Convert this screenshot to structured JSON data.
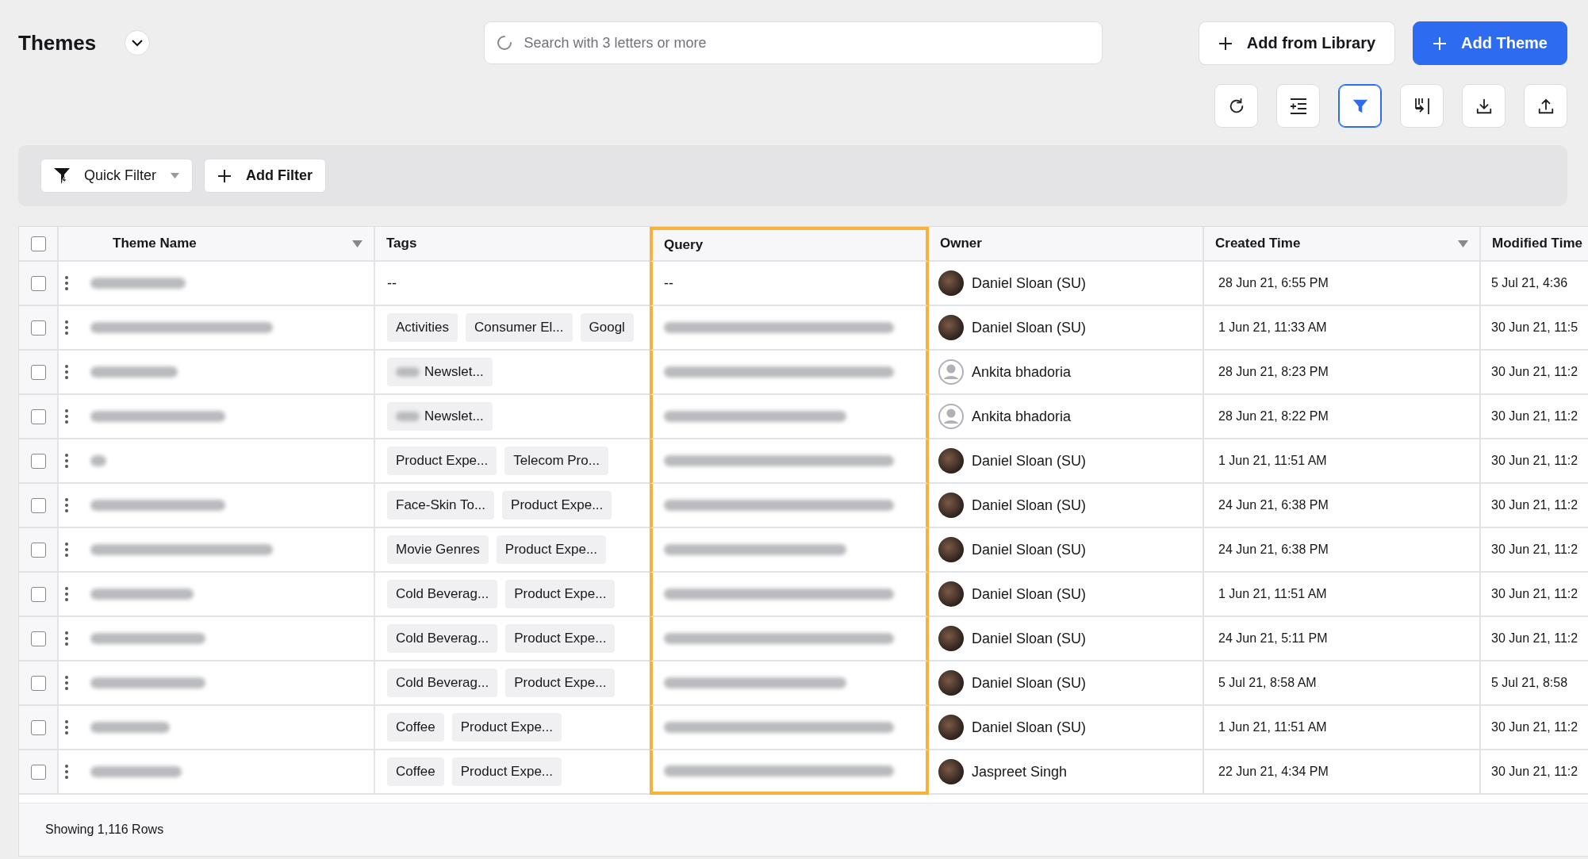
{
  "page": {
    "title": "Themes"
  },
  "search": {
    "placeholder": "Search with 3 letters or more"
  },
  "actions": [
    {
      "label": "Add from Library",
      "primary": false
    },
    {
      "label": "Add Theme",
      "primary": true
    }
  ],
  "tool_buttons": [
    {
      "kind": "refresh",
      "selected": false
    },
    {
      "kind": "add-rows",
      "selected": false
    },
    {
      "kind": "filter",
      "selected": true
    },
    {
      "kind": "columns",
      "selected": false
    },
    {
      "kind": "download",
      "selected": false
    },
    {
      "kind": "upload",
      "selected": false
    }
  ],
  "filter_bar": {
    "quick_filter": "Quick Filter",
    "add_filter": "Add Filter"
  },
  "table": {
    "select_all": {
      "checked": false
    },
    "columns": [
      {
        "label": "Theme Name",
        "sortable": true,
        "highlighted": false
      },
      {
        "label": "Tags",
        "sortable": false,
        "highlighted": false
      },
      {
        "label": "Query",
        "sortable": false,
        "highlighted": true
      },
      {
        "label": "Owner",
        "sortable": false,
        "highlighted": false
      },
      {
        "label": "Created Time",
        "sortable": true,
        "highlighted": false
      },
      {
        "label": "Modified Time",
        "highlighted": false
      }
    ],
    "rows": [
      {
        "checked": false,
        "tags_empty": "--",
        "query": "--",
        "owner": {
          "name": "Daniel Sloan (SU)",
          "kind": "photo"
        },
        "created": "28 Jun 21, 6:55 PM",
        "modified": "5 Jul 21, 4:36"
      },
      {
        "checked": false,
        "tags": [
          {
            "label": "Activities",
            "blurred_prefix": false
          },
          {
            "label": "Consumer El...",
            "blurred_prefix": false
          },
          {
            "label": "Googl",
            "blurred_prefix": false
          }
        ],
        "owner": {
          "name": "Daniel Sloan (SU)",
          "kind": "photo"
        },
        "created": "1 Jun 21, 11:33 AM",
        "modified": "30 Jun 21, 11:5"
      },
      {
        "checked": false,
        "tags": [
          {
            "label": "Newslet...",
            "blurred_prefix": true
          }
        ],
        "owner": {
          "name": "Ankita bhadoria",
          "kind": "default"
        },
        "created": "28 Jun 21, 8:23 PM",
        "modified": "30 Jun 21, 11:2"
      },
      {
        "checked": false,
        "tags": [
          {
            "label": "Newslet...",
            "blurred_prefix": true
          }
        ],
        "owner": {
          "name": "Ankita bhadoria",
          "kind": "default"
        },
        "created": "28 Jun 21, 8:22 PM",
        "modified": "30 Jun 21, 11:2"
      },
      {
        "checked": false,
        "tags": [
          {
            "label": "Product Expe...",
            "blurred_prefix": false
          },
          {
            "label": "Telecom Pro...",
            "blurred_prefix": false
          }
        ],
        "owner": {
          "name": "Daniel Sloan (SU)",
          "kind": "photo"
        },
        "created": "1 Jun 21, 11:51 AM",
        "modified": "30 Jun 21, 11:2"
      },
      {
        "checked": false,
        "tags": [
          {
            "label": "Face-Skin To...",
            "blurred_prefix": false
          },
          {
            "label": "Product Expe...",
            "blurred_prefix": false
          }
        ],
        "owner": {
          "name": "Daniel Sloan (SU)",
          "kind": "photo"
        },
        "created": "24 Jun 21, 6:38 PM",
        "modified": "30 Jun 21, 11:2"
      },
      {
        "checked": false,
        "tags": [
          {
            "label": "Movie Genres",
            "blurred_prefix": false
          },
          {
            "label": "Product Expe...",
            "blurred_prefix": false
          }
        ],
        "owner": {
          "name": "Daniel Sloan (SU)",
          "kind": "photo"
        },
        "created": "24 Jun 21, 6:38 PM",
        "modified": "30 Jun 21, 11:2"
      },
      {
        "checked": false,
        "tags": [
          {
            "label": "Cold Beverag...",
            "blurred_prefix": false
          },
          {
            "label": "Product Expe...",
            "blurred_prefix": false
          }
        ],
        "owner": {
          "name": "Daniel Sloan (SU)",
          "kind": "photo"
        },
        "created": "1 Jun 21, 11:51 AM",
        "modified": "30 Jun 21, 11:2"
      },
      {
        "checked": false,
        "tags": [
          {
            "label": "Cold Beverag...",
            "blurred_prefix": false
          },
          {
            "label": "Product Expe...",
            "blurred_prefix": false
          }
        ],
        "owner": {
          "name": "Daniel Sloan (SU)",
          "kind": "photo"
        },
        "created": "24 Jun 21, 5:11 PM",
        "modified": "30 Jun 21, 11:2"
      },
      {
        "checked": false,
        "tags": [
          {
            "label": "Cold Beverag...",
            "blurred_prefix": false
          },
          {
            "label": "Product Expe...",
            "blurred_prefix": false
          }
        ],
        "owner": {
          "name": "Daniel Sloan (SU)",
          "kind": "photo"
        },
        "created": "5 Jul 21, 8:58 AM",
        "modified": "5 Jul 21, 8:58"
      },
      {
        "checked": false,
        "tags": [
          {
            "label": "Coffee",
            "blurred_prefix": false
          },
          {
            "label": "Product Expe...",
            "blurred_prefix": false
          }
        ],
        "owner": {
          "name": "Daniel Sloan (SU)",
          "kind": "photo"
        },
        "created": "1 Jun 21, 11:51 AM",
        "modified": "30 Jun 21, 11:2"
      },
      {
        "checked": false,
        "tags": [
          {
            "label": "Coffee",
            "blurred_prefix": false
          },
          {
            "label": "Product Expe...",
            "blurred_prefix": false
          }
        ],
        "owner": {
          "name": "Jaspreet Singh",
          "kind": "photo"
        },
        "created": "22 Jun 21, 4:34 PM",
        "modified": "30 Jun 21, 11:2"
      }
    ],
    "footer": "Showing 1,116 Rows"
  }
}
